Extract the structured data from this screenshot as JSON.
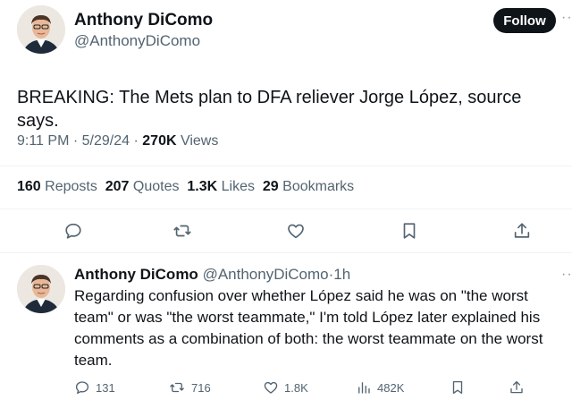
{
  "main_tweet": {
    "author_name": "Anthony DiComo",
    "author_handle": "@AnthonyDiComo",
    "follow_label": "Follow",
    "text": "BREAKING: The Mets plan to DFA reliever Jorge López, source says.",
    "time": "9:11 PM",
    "date": "5/29/24",
    "separator": "·",
    "views_count": "270K",
    "views_label": "Views",
    "stats": {
      "reposts_count": "160",
      "reposts_label": "Reposts",
      "quotes_count": "207",
      "quotes_label": "Quotes",
      "likes_count": "1.3K",
      "likes_label": "Likes",
      "bookmarks_count": "29",
      "bookmarks_label": "Bookmarks"
    }
  },
  "reply_tweet": {
    "author_name": "Anthony DiComo",
    "author_handle": "@AnthonyDiComo",
    "separator": "·",
    "time_ago": "1h",
    "text": "Regarding confusion over whether López said he was on \"the worst team\" or was \"the worst teammate,\" I'm told López later explained his comments as a combination of both: the worst teammate on the worst team.",
    "counts": {
      "replies": "131",
      "reposts": "716",
      "likes": "1.8K",
      "views": "482K"
    }
  },
  "icons": [
    "reply-icon",
    "repost-icon",
    "like-icon",
    "bookmark-icon",
    "share-icon",
    "views-icon",
    "more-icon"
  ],
  "colors": {
    "text": "#0f1419",
    "secondary": "#536471",
    "divider": "#eff3f4",
    "follow_bg": "#0f1419"
  }
}
